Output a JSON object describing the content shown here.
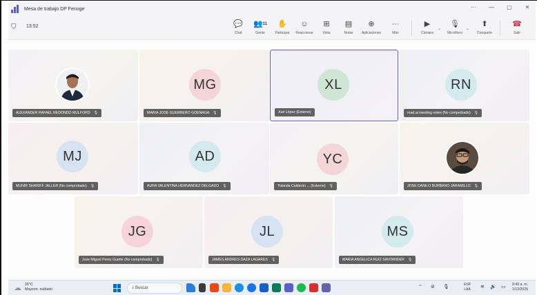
{
  "window": {
    "title": "Mesa de trabajo DP Fenoge",
    "controls": [
      "···",
      "—",
      "▢",
      "✕"
    ]
  },
  "meeting": {
    "elapsed": "13:52",
    "people_count": "11",
    "toolbar": {
      "chat": "Chat",
      "gente": "Gente",
      "participar": "Participar",
      "reaccionar": "Reaccionar",
      "vista": "Vista",
      "notas": "Notas",
      "aplicaciones": "Aplicaciones",
      "mas": "Más",
      "camara": "Cámara",
      "microfono": "Micrófono",
      "comparte": "Comparte",
      "salir": "Salir"
    }
  },
  "participants": [
    {
      "initials": "",
      "name": "ALEXANDER RAFAEL REDONDO MULFORD",
      "photo": true
    },
    {
      "initials": "MG",
      "name": "MARIA JOSE GUERRERO GOENAGA",
      "avatar_color": "#f4d6d9"
    },
    {
      "initials": "XL",
      "name": "Xué López (Externo)",
      "avatar_color": "#cfe6d4",
      "active": true
    },
    {
      "initials": "RN",
      "name": "read.ai meeting notes (No comprobado)",
      "avatar_color": "#d3ebee"
    },
    {
      "initials": "MJ",
      "name": "MUNIR SHARIFF JALLER (No comprobado)",
      "avatar_color": "#d5e3f2"
    },
    {
      "initials": "AD",
      "name": "AURA VALENTINA HERNANDEZ DELGADO",
      "avatar_color": "#d3ebee"
    },
    {
      "initials": "YC",
      "name": "Yolanda Calderón ... (Externo)",
      "avatar_color": "#f4d6d9"
    },
    {
      "initials": "",
      "name": "JOSE DANILO BURBANO JARAMILLO",
      "photo": true
    },
    {
      "initials": "JG",
      "name": "Jose Miguel Perez Guette (No comprobado)",
      "avatar_color": "#f6d3dc"
    },
    {
      "initials": "JL",
      "name": "JAMES ANDRES DAZA LAGARES",
      "avatar_color": "#d5e3f2"
    },
    {
      "initials": "MS",
      "name": "MARIA ANGELICA RUIZ SANTANDER",
      "avatar_color": "#d3ebee"
    }
  ],
  "taskbar": {
    "temperature": "26°C",
    "weather": "Mayorm. nublado",
    "search_label": "Buscar",
    "lang_top": "ESP",
    "lang_bottom": "LAA",
    "time": "9:43 a. m.",
    "date": "1/12/2025"
  }
}
